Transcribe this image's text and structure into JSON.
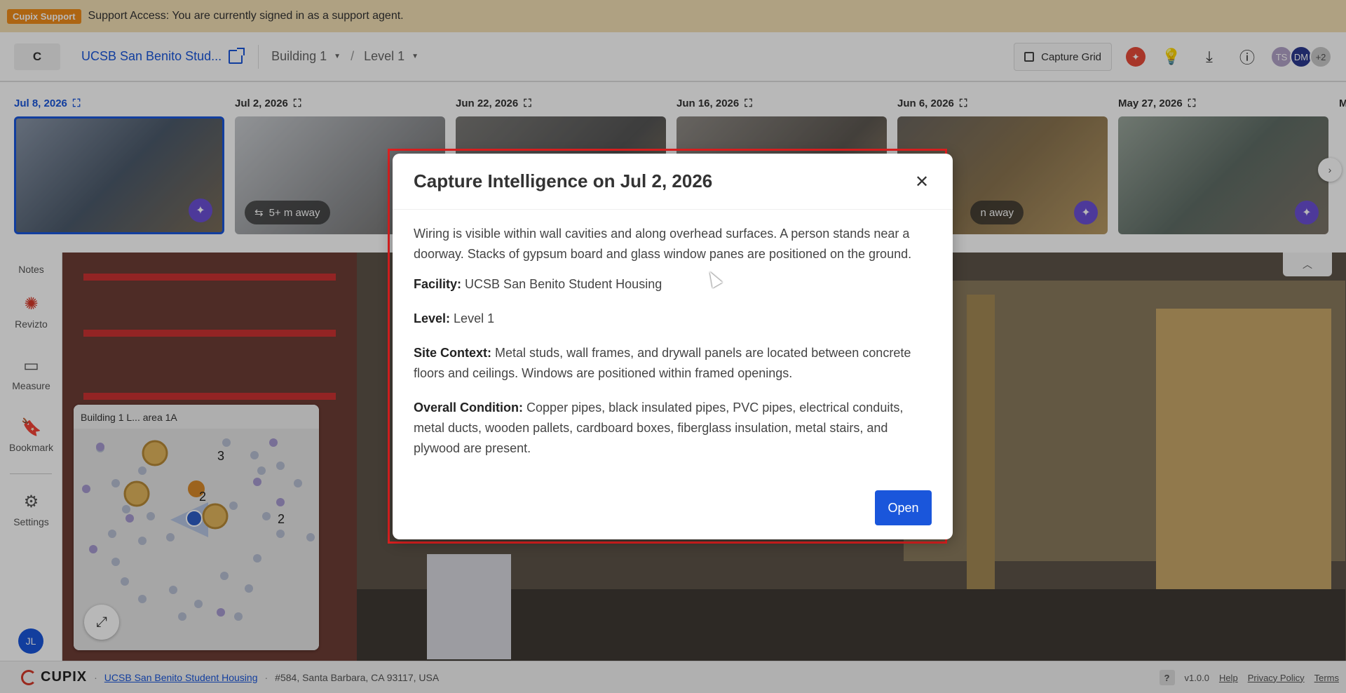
{
  "support": {
    "badge": "Cupix Support",
    "message": "Support Access: You are currently signed in as a support agent."
  },
  "header": {
    "home_label": "C",
    "project_name": "UCSB San Benito Stud...",
    "building": "Building 1",
    "level": "Level 1",
    "capture_grid_label": "Capture Grid",
    "avatars": [
      {
        "initials": "TS",
        "color": "#b2a3c8"
      },
      {
        "initials": "DM",
        "color": "#2b3a8f"
      },
      {
        "initials": "+2",
        "color": "#c9c9c9"
      }
    ]
  },
  "timeline": {
    "items": [
      {
        "date": "Jul 8, 2026",
        "active": true,
        "away": ""
      },
      {
        "date": "Jul 2, 2026",
        "active": false,
        "away": "5+ m away"
      },
      {
        "date": "Jun 22, 2026",
        "active": false,
        "away": ""
      },
      {
        "date": "Jun 16, 2026",
        "active": false,
        "away": ""
      },
      {
        "date": "Jun 6, 2026",
        "active": false,
        "away": "n away"
      },
      {
        "date": "May 27, 2026",
        "active": false,
        "away": ""
      },
      {
        "date": "M",
        "active": false,
        "away": ""
      }
    ]
  },
  "rail": {
    "notes": "Notes",
    "revizto": "Revizto",
    "measure": "Measure",
    "bookmark": "Bookmark",
    "settings": "Settings",
    "user_initials": "JL"
  },
  "minimap": {
    "title": "Building 1 L... area 1A",
    "clusters": [
      "3",
      "2",
      "2"
    ]
  },
  "modal": {
    "title": "Capture Intelligence on Jul 2, 2026",
    "summary": "Wiring is visible within wall cavities and along overhead surfaces. A person stands near a doorway. Stacks of gypsum board and glass window panes are positioned on the ground.",
    "facility_label": "Facility:",
    "facility_value": "UCSB San Benito Student Housing",
    "level_label": "Level:",
    "level_value": "Level 1",
    "site_label": "Site Context:",
    "site_value": "Metal studs, wall frames, and drywall panels are located between concrete floors and ceilings. Windows are positioned within framed openings.",
    "condition_label": "Overall Condition:",
    "condition_value": "Copper pipes, black insulated pipes, PVC pipes, electrical conduits, metal ducts, wooden pallets, cardboard boxes, fiberglass insulation, metal stairs, and plywood are present.",
    "open_label": "Open"
  },
  "footer": {
    "brand": "CUPIX",
    "project_link": "UCSB San Benito Student Housing",
    "address": "#584, Santa Barbara, CA 93117, USA",
    "help_box": "?",
    "version": "v1.0.0",
    "help": "Help",
    "privacy": "Privacy Policy",
    "terms": "Terms"
  }
}
